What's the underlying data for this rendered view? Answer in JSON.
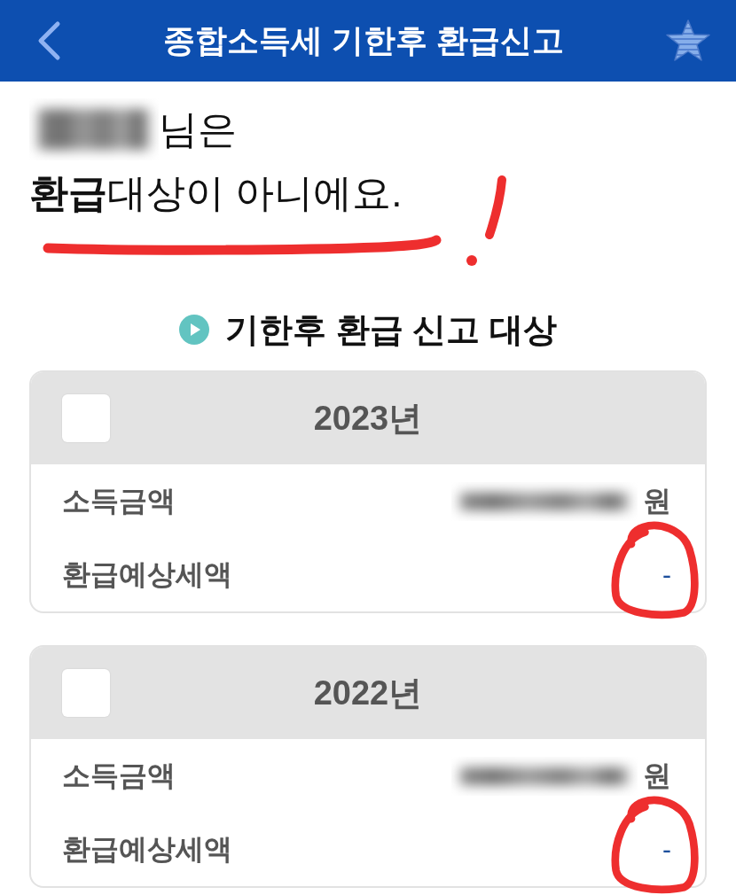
{
  "header": {
    "title": "종합소득세 기한후 환급신고"
  },
  "greeting": {
    "name_blurred": true,
    "suffix": "님은",
    "message": "**환급**대상이 아니에요.",
    "underlined": true,
    "exclamation_mark": true
  },
  "section": {
    "title": "기한후 환급 신고 대상"
  },
  "years": [
    {
      "label": "2023년",
      "checked": false,
      "rows": [
        {
          "kind": "amount",
          "label": "소득금액",
          "value_blurred": true,
          "unit": "원"
        },
        {
          "kind": "refund",
          "label": "환급예상세액",
          "value": "-",
          "circled": true
        }
      ]
    },
    {
      "label": "2022년",
      "checked": false,
      "rows": [
        {
          "kind": "amount",
          "label": "소득금액",
          "value_blurred": true,
          "unit": "원"
        },
        {
          "kind": "refund",
          "label": "환급예상세액",
          "value": "-",
          "circled": true
        }
      ]
    }
  ]
}
